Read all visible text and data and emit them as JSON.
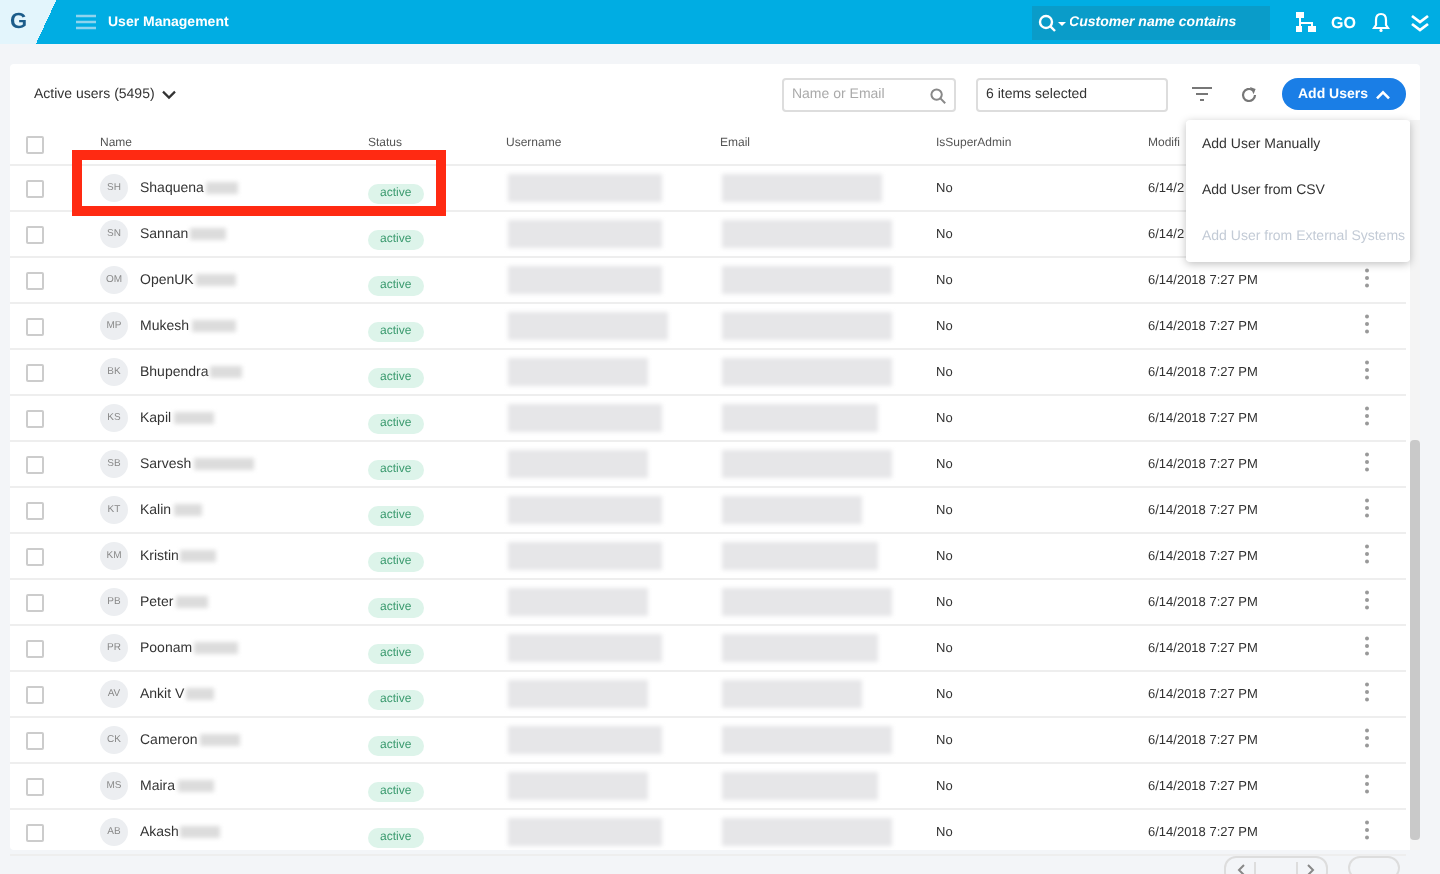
{
  "app_bar": {
    "logo": "G",
    "title": "User Management",
    "search": {
      "placeholder": "Customer name contains"
    },
    "badge": "GO"
  },
  "toolbar": {
    "view": "Active users (5495)",
    "search": {
      "placeholder": "Name or Email"
    },
    "filter": {
      "value": "6 items selected"
    },
    "button": "Add Users",
    "menu_open": true
  },
  "menu": [
    {
      "label": "Add User Manually",
      "disabled": false
    },
    {
      "label": "Add User from CSV",
      "disabled": false
    },
    {
      "label": "Add User from External Systems",
      "disabled": true
    }
  ],
  "table": {
    "select_all_checked": false,
    "columns": [
      "Name",
      "Status",
      "Username",
      "Email",
      "IsSuperAdmin",
      "Modifi"
    ],
    "rows": [
      {
        "initials": "SH",
        "name": "Shaquena",
        "status": "active",
        "admin": "No",
        "modified": "6/14/2",
        "actions": false,
        "highlighted": true,
        "checked": false
      },
      {
        "initials": "SN",
        "name": "Sannan",
        "status": "active",
        "admin": "No",
        "modified": "6/14/2",
        "actions": false,
        "highlighted": false,
        "checked": false
      },
      {
        "initials": "OM",
        "name": "OpenUK",
        "status": "active",
        "admin": "No",
        "modified": "6/14/2018 7:27 PM",
        "actions": true,
        "highlighted": false,
        "checked": false
      },
      {
        "initials": "MP",
        "name": "Mukesh",
        "status": "active",
        "admin": "No",
        "modified": "6/14/2018 7:27 PM",
        "actions": true,
        "highlighted": false,
        "checked": false
      },
      {
        "initials": "BK",
        "name": "Bhupendra",
        "status": "active",
        "admin": "No",
        "modified": "6/14/2018 7:27 PM",
        "actions": true,
        "highlighted": false,
        "checked": false
      },
      {
        "initials": "KS",
        "name": "Kapil",
        "status": "active",
        "admin": "No",
        "modified": "6/14/2018 7:27 PM",
        "actions": true,
        "highlighted": false,
        "checked": false
      },
      {
        "initials": "SB",
        "name": "Sarvesh",
        "status": "active",
        "admin": "No",
        "modified": "6/14/2018 7:27 PM",
        "actions": true,
        "highlighted": false,
        "checked": false
      },
      {
        "initials": "KT",
        "name": "Kalin",
        "status": "active",
        "admin": "No",
        "modified": "6/14/2018 7:27 PM",
        "actions": true,
        "highlighted": false,
        "checked": false
      },
      {
        "initials": "KM",
        "name": "Kristin",
        "status": "active",
        "admin": "No",
        "modified": "6/14/2018 7:27 PM",
        "actions": true,
        "highlighted": false,
        "checked": false
      },
      {
        "initials": "PB",
        "name": "Peter",
        "status": "active",
        "admin": "No",
        "modified": "6/14/2018 7:27 PM",
        "actions": true,
        "highlighted": false,
        "checked": false
      },
      {
        "initials": "PR",
        "name": "Poonam",
        "status": "active",
        "admin": "No",
        "modified": "6/14/2018 7:27 PM",
        "actions": true,
        "highlighted": false,
        "checked": false
      },
      {
        "initials": "AV",
        "name": "Ankit V",
        "status": "active",
        "admin": "No",
        "modified": "6/14/2018 7:27 PM",
        "actions": true,
        "highlighted": false,
        "checked": false
      },
      {
        "initials": "CK",
        "name": "Cameron",
        "status": "active",
        "admin": "No",
        "modified": "6/14/2018 7:27 PM",
        "actions": true,
        "highlighted": false,
        "checked": false
      },
      {
        "initials": "MS",
        "name": "Maira",
        "status": "active",
        "admin": "No",
        "modified": "6/14/2018 7:27 PM",
        "actions": true,
        "highlighted": false,
        "checked": false
      },
      {
        "initials": "AB",
        "name": "Akash",
        "status": "active",
        "admin": "No",
        "modified": "6/14/2018 7:27 PM",
        "actions": true,
        "highlighted": false,
        "checked": false
      }
    ]
  }
}
